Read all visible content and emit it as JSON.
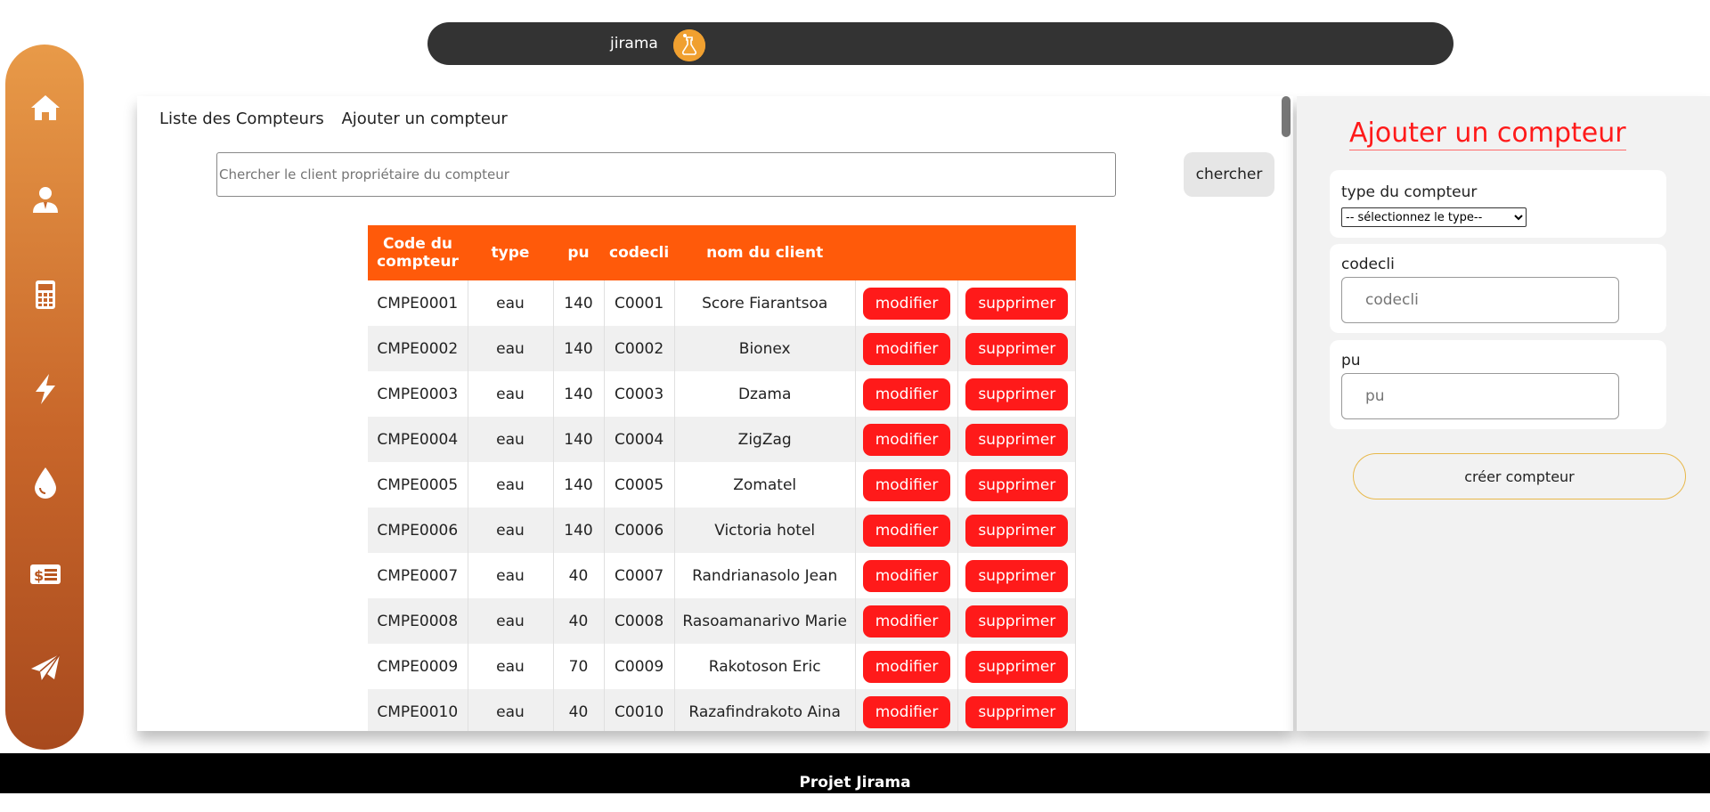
{
  "topbar": {
    "brand": "jirama",
    "logo_icon": "flask-logo-icon"
  },
  "sidebar": {
    "items": [
      {
        "icon": "home-icon"
      },
      {
        "icon": "user-icon"
      },
      {
        "icon": "calculator-icon"
      },
      {
        "icon": "bolt-icon"
      },
      {
        "icon": "water-drop-icon"
      },
      {
        "icon": "money-list-icon"
      },
      {
        "icon": "send-icon"
      }
    ]
  },
  "main": {
    "tabs": [
      "Liste des Compteurs",
      "Ajouter un compteur"
    ],
    "search": {
      "placeholder": "Chercher le client propriétaire du compteur",
      "value": ""
    },
    "search_button": "chercher",
    "table": {
      "headers": [
        "Code du compteur",
        "type",
        "pu",
        "codecli",
        "nom du client",
        "",
        ""
      ],
      "edit_label": "modifier",
      "delete_label": "supprimer",
      "rows": [
        {
          "code": "CMPE0001",
          "type": "eau",
          "pu": "140",
          "codecli": "C0001",
          "nom": "Score Fiarantsoa"
        },
        {
          "code": "CMPE0002",
          "type": "eau",
          "pu": "140",
          "codecli": "C0002",
          "nom": "Bionex"
        },
        {
          "code": "CMPE0003",
          "type": "eau",
          "pu": "140",
          "codecli": "C0003",
          "nom": "Dzama"
        },
        {
          "code": "CMPE0004",
          "type": "eau",
          "pu": "140",
          "codecli": "C0004",
          "nom": "ZigZag"
        },
        {
          "code": "CMPE0005",
          "type": "eau",
          "pu": "140",
          "codecli": "C0005",
          "nom": "Zomatel"
        },
        {
          "code": "CMPE0006",
          "type": "eau",
          "pu": "140",
          "codecli": "C0006",
          "nom": "Victoria hotel"
        },
        {
          "code": "CMPE0007",
          "type": "eau",
          "pu": "40",
          "codecli": "C0007",
          "nom": "Randrianasolo Jean"
        },
        {
          "code": "CMPE0008",
          "type": "eau",
          "pu": "40",
          "codecli": "C0008",
          "nom": "Rasoamanarivo Marie"
        },
        {
          "code": "CMPE0009",
          "type": "eau",
          "pu": "70",
          "codecli": "C0009",
          "nom": "Rakotoson Eric"
        },
        {
          "code": "CMPE0010",
          "type": "eau",
          "pu": "40",
          "codecli": "C0010",
          "nom": "Razafindrakoto Aina"
        }
      ]
    }
  },
  "form": {
    "title": "Ajouter un compteur",
    "type_label": "type du compteur",
    "type_select": "-- sélectionnez le type-- ",
    "codecli_label": "codecli",
    "codecli_placeholder": "codecli",
    "pu_label": "pu",
    "pu_placeholder": "pu",
    "submit": "créer compteur"
  },
  "footer": {
    "text": "Projet Jirama"
  },
  "colors": {
    "accent": "#ff5a0a",
    "danger": "#ff1a1a",
    "sidebar_top": "#e89a48",
    "sidebar_bottom": "#a84a1e"
  }
}
